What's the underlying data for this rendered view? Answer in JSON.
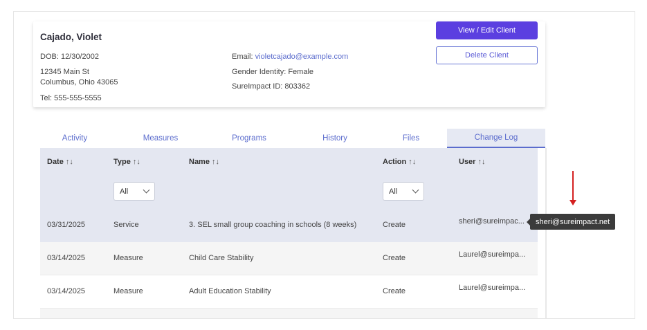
{
  "client": {
    "name": "Cajado, Violet",
    "dob": "DOB: 12/30/2002",
    "address_line1": "12345 Main St",
    "address_line2": "Columbus, Ohio 43065",
    "tel": "Tel: 555-555-5555",
    "email_label": "Email: ",
    "email": "violetcajado@example.com",
    "gender": "Gender Identity: Female",
    "sureimpact_id": "SureImpact ID: 803362"
  },
  "actions": {
    "view_edit": "View / Edit Client",
    "delete": "Delete Client"
  },
  "tabs": [
    {
      "label": "Activity"
    },
    {
      "label": "Measures"
    },
    {
      "label": "Programs"
    },
    {
      "label": "History"
    },
    {
      "label": "Files"
    },
    {
      "label": "Change Log",
      "active": true
    }
  ],
  "table": {
    "columns": [
      "Date",
      "Type",
      "Name",
      "Action",
      "User"
    ],
    "sort_glyph": "↑↓",
    "filters": {
      "type": "All",
      "action": "All"
    },
    "rows": [
      {
        "date": "03/31/2025",
        "type": "Service",
        "name": "3. SEL small group coaching in schools (8 weeks)",
        "action": "Create",
        "user": "sheri@sureimpac..."
      },
      {
        "date": "03/14/2025",
        "type": "Measure",
        "name": "Child Care Stability",
        "action": "Create",
        "user": "Laurel@sureimpa..."
      },
      {
        "date": "03/14/2025",
        "type": "Measure",
        "name": "Adult Education Stability",
        "action": "Create",
        "user": "Laurel@sureimpa..."
      }
    ]
  },
  "tooltip": {
    "text": "sheri@sureimpact.net"
  },
  "colors": {
    "accent": "#5b6ccd",
    "primary_button": "#5b3fe0",
    "header_bg": "#e4e7f1",
    "annotation_arrow": "#d42020"
  }
}
